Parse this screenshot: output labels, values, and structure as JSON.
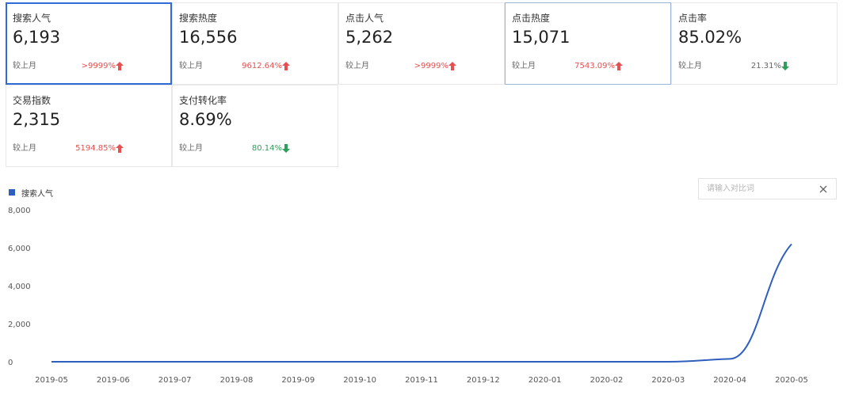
{
  "metrics": [
    {
      "label": "搜索人气",
      "value": "6,193",
      "compare_label": "较上月",
      "change": ">9999%",
      "direction": "up"
    },
    {
      "label": "搜索热度",
      "value": "16,556",
      "compare_label": "较上月",
      "change": "9612.64%",
      "direction": "up"
    },
    {
      "label": "点击人气",
      "value": "5,262",
      "compare_label": "较上月",
      "change": ">9999%",
      "direction": "up"
    },
    {
      "label": "点击热度",
      "value": "15,071",
      "compare_label": "较上月",
      "change": "7543.09%",
      "direction": "up"
    },
    {
      "label": "点击率",
      "value": "85.02%",
      "compare_label": "较上月",
      "change": "21.31%",
      "direction": "down"
    },
    {
      "label": "交易指数",
      "value": "2,315",
      "compare_label": "较上月",
      "change": "5194.85%",
      "direction": "up"
    },
    {
      "label": "支付转化率",
      "value": "8.69%",
      "compare_label": "较上月",
      "change": "80.14%",
      "direction": "down"
    }
  ],
  "colors": {
    "up": "#e55050",
    "down": "#2e9e5b",
    "series": "#2e5fbf",
    "selected_border": "#2e6bd6"
  },
  "compare_input": {
    "placeholder": "请输入对比词"
  },
  "chart_data": {
    "type": "line",
    "x": [
      "2019-05",
      "2019-06",
      "2019-07",
      "2019-08",
      "2019-09",
      "2019-10",
      "2019-11",
      "2019-12",
      "2020-01",
      "2020-02",
      "2020-03",
      "2020-04",
      "2020-05"
    ],
    "series": [
      {
        "name": "搜索人气",
        "values": [
          0,
          0,
          0,
          0,
          0,
          0,
          0,
          0,
          0,
          0,
          0,
          150,
          6193
        ]
      }
    ],
    "yticks": [
      "8,000",
      "6,000",
      "4,000",
      "2,000",
      "0"
    ],
    "ylim": [
      0,
      8000
    ],
    "grid": false,
    "legend": "top-left"
  }
}
